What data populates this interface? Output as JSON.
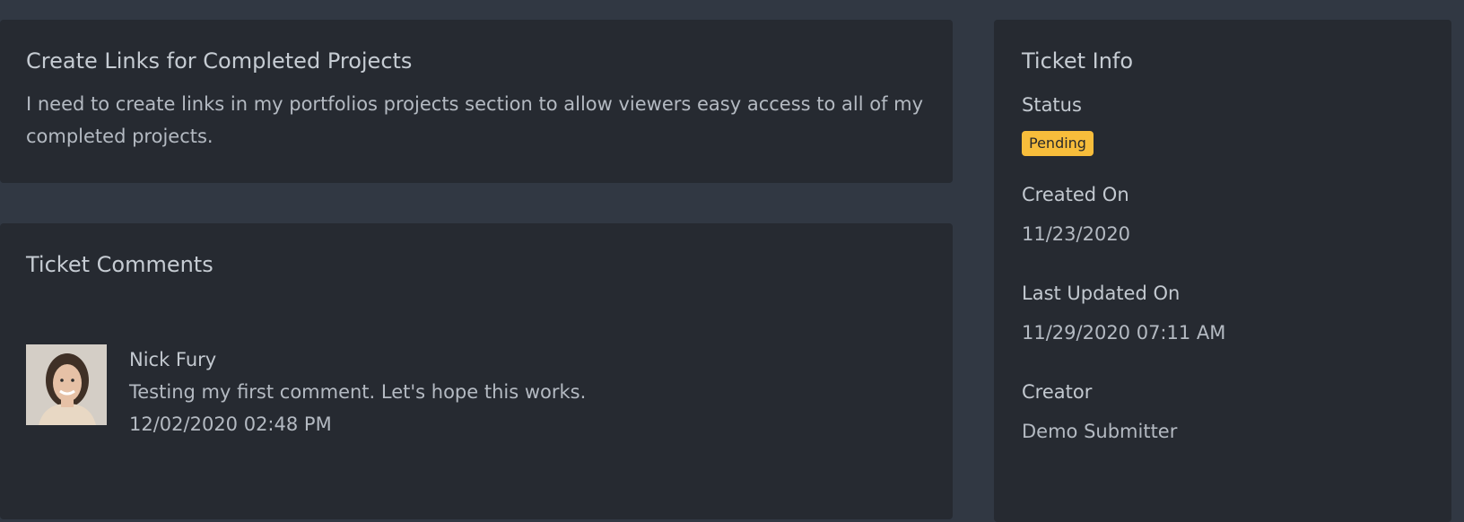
{
  "ticket": {
    "title": "Create Links for Completed Projects",
    "description": "I need to create links in my portfolios projects section to allow viewers easy access to all of my completed projects."
  },
  "comments": {
    "title": "Ticket Comments",
    "items": [
      {
        "author": "Nick Fury",
        "text": "Testing my first comment. Let's hope this works.",
        "date": "12/02/2020 02:48 PM"
      }
    ]
  },
  "info": {
    "title": "Ticket Info",
    "status_label": "Status",
    "status_value": "Pending",
    "status_color": "#f7bd3b",
    "created_label": "Created On",
    "created_value": "11/23/2020",
    "updated_label": "Last Updated On",
    "updated_value": "11/29/2020 07:11 AM",
    "creator_label": "Creator",
    "creator_value": "Demo Submitter"
  },
  "colors": {
    "background": "#313843",
    "card": "#262a31"
  }
}
